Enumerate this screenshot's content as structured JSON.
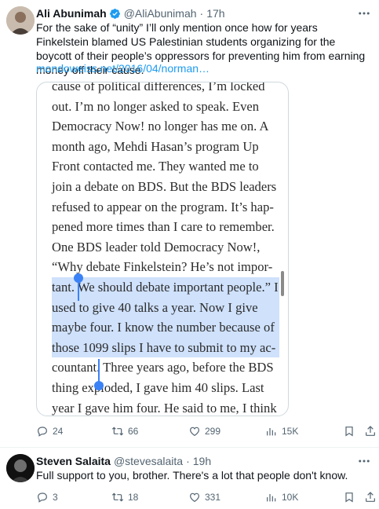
{
  "tweet1": {
    "author_name": "Ali Abunimah",
    "author_handle": "@AliAbunimah",
    "dot": "·",
    "time": "17h",
    "text": "For the sake of “unity” I’ll only mention once how for years Finkelstein blamed US Palestinian students organizing for the boycott of their people’s oppressors for preventing him from earning money off their cause.",
    "link": "mondoweiss.net/2016/04/norman…",
    "image_lines": [
      "cause of political differences, I’m locked",
      "out. I’m no longer asked to speak. Even",
      "Democracy Now! no longer has me on. A",
      "month ago, Mehdi Hasan’s program Up",
      "Front contacted me. They wanted me to",
      "join a debate on BDS. But the BDS leaders",
      "refused to appear on the program. It’s hap-",
      "pened more times than I care to remember.",
      "One BDS leader told Democracy Now!,",
      "“Why debate Finkelstein? He’s not impor-",
      "tant. We should debate important people.” I",
      "used to give 40 talks a year. Now I give",
      "maybe four. I know the number because of",
      "those 1099 slips I have to submit to my ac-",
      "countant. Three years ago, before the BDS",
      "thing exploded, I gave him 40 slips. Last",
      "year I gave him four. He said to me, I think"
    ],
    "stats": {
      "replies": "24",
      "reposts": "66",
      "likes": "299",
      "views": "15K"
    },
    "verified_color": "#1d9bf0"
  },
  "tweet2": {
    "author_name": "Steven Salaita",
    "author_handle": "@stevesalaita",
    "dot": "·",
    "time": "19h",
    "text": "Full support to you, brother.  There's a lot that people don't know.",
    "stats": {
      "replies": "3",
      "reposts": "18",
      "likes": "331",
      "views": "10K"
    }
  },
  "colors": {
    "accent": "#1d9bf0",
    "secondary_text": "#536471",
    "selection": "#cfe1fb",
    "selection_handle": "#3b82f6"
  },
  "icons": [
    "more-icon",
    "verified-badge-icon",
    "reply-icon",
    "repost-icon",
    "like-icon",
    "views-icon",
    "bookmark-icon",
    "share-icon"
  ]
}
